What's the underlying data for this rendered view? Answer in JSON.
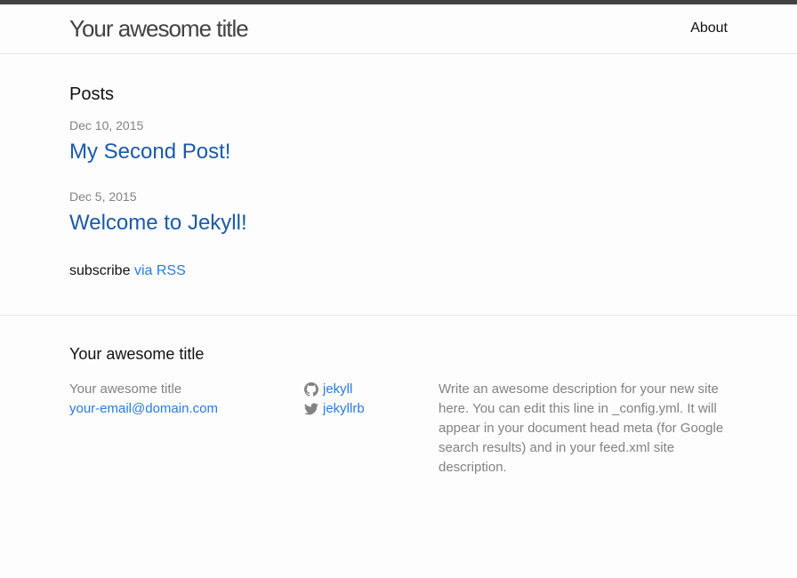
{
  "header": {
    "site_title": "Your awesome title",
    "nav": [
      {
        "label": "About"
      }
    ]
  },
  "main": {
    "heading": "Posts",
    "posts": [
      {
        "date": "Dec 10, 2015",
        "title": "My Second Post!"
      },
      {
        "date": "Dec 5, 2015",
        "title": "Welcome to Jekyll!"
      }
    ],
    "rss_prefix": "subscribe",
    "rss_link": "via RSS"
  },
  "footer": {
    "heading": "Your awesome title",
    "name": "Your awesome title",
    "email": "your-email@domain.com",
    "social": [
      {
        "icon": "github-icon",
        "label": "jekyll"
      },
      {
        "icon": "twitter-icon",
        "label": "jekyllrb"
      }
    ],
    "description": "Write an awesome description for your new site here. You can edit this line in _config.yml. It will appear in your document head meta (for Google search results) and in your feed.xml site description."
  },
  "colors": {
    "text": "#111111",
    "link": "#2a7ae2",
    "meta": "#828282",
    "header_border": "#424242",
    "divider": "#e8e8e8",
    "background": "#fdfdfd"
  }
}
